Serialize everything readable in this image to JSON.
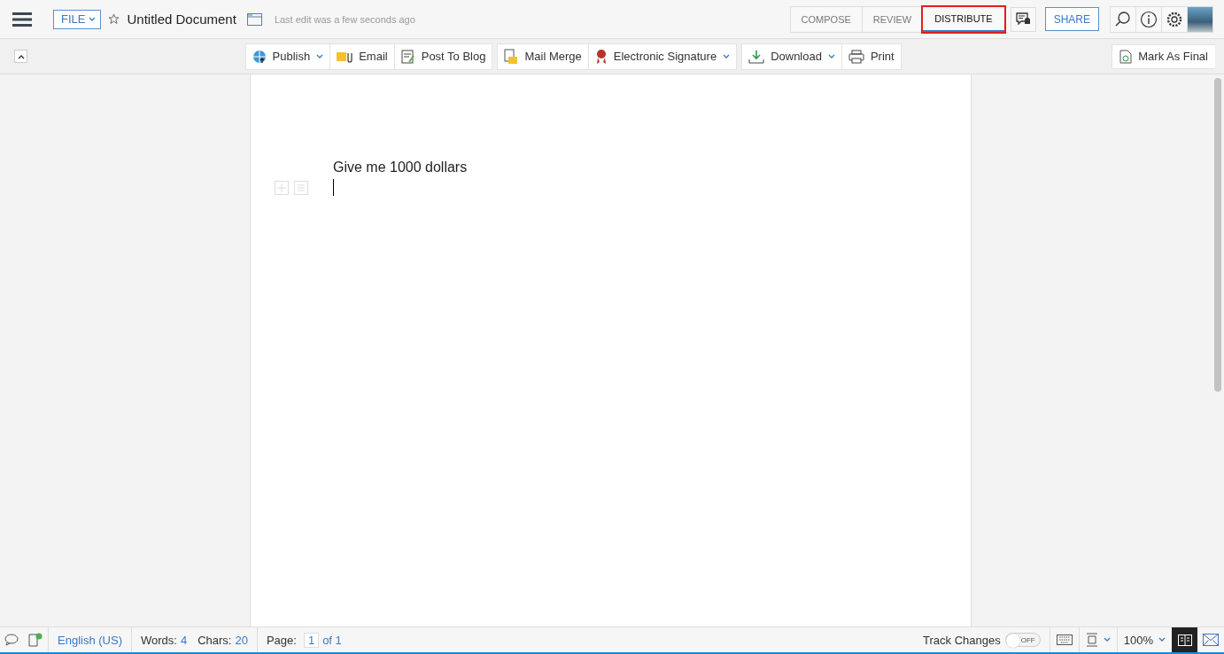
{
  "header": {
    "file_menu": "FILE",
    "document_title": "Untitled Document",
    "last_edit": "Last edit was a few seconds ago",
    "starred": false,
    "modes": [
      {
        "label": "COMPOSE",
        "selected": false,
        "highlighted": false
      },
      {
        "label": "REVIEW",
        "selected": false,
        "highlighted": false
      },
      {
        "label": "DISTRIBUTE",
        "selected": true,
        "highlighted": true
      }
    ],
    "share": "SHARE"
  },
  "toolbar": {
    "groups": [
      [
        {
          "label": "Publish",
          "dropdown": true
        },
        {
          "label": "Email",
          "dropdown": false
        },
        {
          "label": "Post To Blog",
          "dropdown": false
        }
      ],
      [
        {
          "label": "Mail Merge",
          "dropdown": false
        },
        {
          "label": "Electronic Signature",
          "dropdown": true
        }
      ],
      [
        {
          "label": "Download",
          "dropdown": true
        },
        {
          "label": "Print",
          "dropdown": false
        }
      ]
    ],
    "mark_final": "Mark As Final"
  },
  "document": {
    "text": "Give me 1000 dollars"
  },
  "status_bar": {
    "language": "English (US)",
    "words_label": "Words:",
    "words": "4",
    "chars_label": "Chars:",
    "chars": "20",
    "page_label": "Page:",
    "page": "1",
    "page_total": "of 1",
    "track_changes": "Track Changes",
    "track_on": false,
    "toggle_text": "OFF",
    "zoom": "100%"
  }
}
